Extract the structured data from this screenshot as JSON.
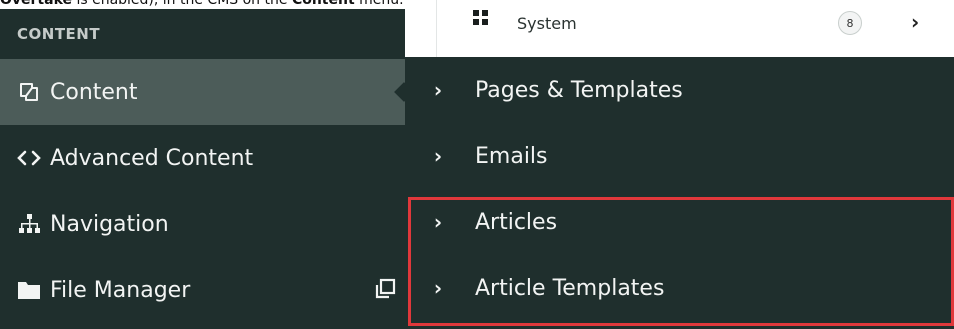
{
  "note": {
    "text_bold": "Overtake",
    "text_rest": " is enabled), in the CMS on the ",
    "text_bold2": "Content",
    "text_end": " menu."
  },
  "sidebar": {
    "header": "CONTENT",
    "items": [
      {
        "label": "Content",
        "icon": "content-icon",
        "active": true
      },
      {
        "label": "Advanced Content",
        "icon": "code-icon",
        "active": false
      },
      {
        "label": "Navigation",
        "icon": "sitemap-icon",
        "active": false
      },
      {
        "label": "File Manager",
        "icon": "folder-icon",
        "active": false
      }
    ]
  },
  "system": {
    "label": "System",
    "badge": "8",
    "icon": "grid-icon"
  },
  "flyout": {
    "items": [
      {
        "label": "Pages & Templates"
      },
      {
        "label": "Emails"
      },
      {
        "label": "Articles"
      },
      {
        "label": "Article Templates"
      }
    ]
  },
  "colors": {
    "sidebar_bg": "#1f2f2d",
    "active_bg": "#4c5c59",
    "highlight_border": "#e0383b"
  }
}
